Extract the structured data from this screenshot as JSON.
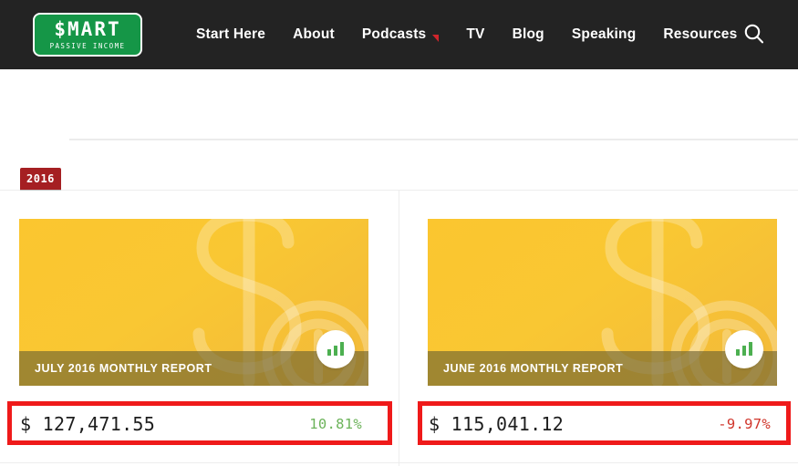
{
  "header": {
    "logo": {
      "name": "Smart Passive Income",
      "main_text": "$MART",
      "sub_text": "PASSIVE INCOME",
      "plate_color": "#159647"
    },
    "nav_items": [
      {
        "label": "Start Here",
        "has_caret": false
      },
      {
        "label": "About",
        "has_caret": false
      },
      {
        "label": "Podcasts",
        "has_caret": true
      },
      {
        "label": "TV",
        "has_caret": false
      },
      {
        "label": "Blog",
        "has_caret": false
      },
      {
        "label": "Speaking",
        "has_caret": false
      },
      {
        "label": "Resources",
        "has_caret": false
      }
    ],
    "search_icon": "search-icon",
    "background_color": "#232323",
    "caret_color": "#d0252b"
  },
  "section": {
    "year_badge": "2016",
    "year_badge_color": "#a51f22"
  },
  "reports": [
    {
      "title": "JULY 2016 MONTHLY REPORT",
      "currency_symbol": "$",
      "amount": "127,471.55",
      "amount_display": "$ 127,471.55",
      "change_pct": "10.81%",
      "change_direction": "up",
      "change_color": "#6cb35a",
      "badge_icon": "bar-chart-icon"
    },
    {
      "title": "JUNE 2016 MONTHLY REPORT",
      "currency_symbol": "$",
      "amount": "115,041.12",
      "amount_display": "$ 115,041.12",
      "change_pct": "-9.97%",
      "change_direction": "down",
      "change_color": "#d0352b",
      "badge_icon": "bar-chart-icon"
    }
  ],
  "annotations": {
    "highlight_color": "#ef1a1a",
    "count": 2
  }
}
